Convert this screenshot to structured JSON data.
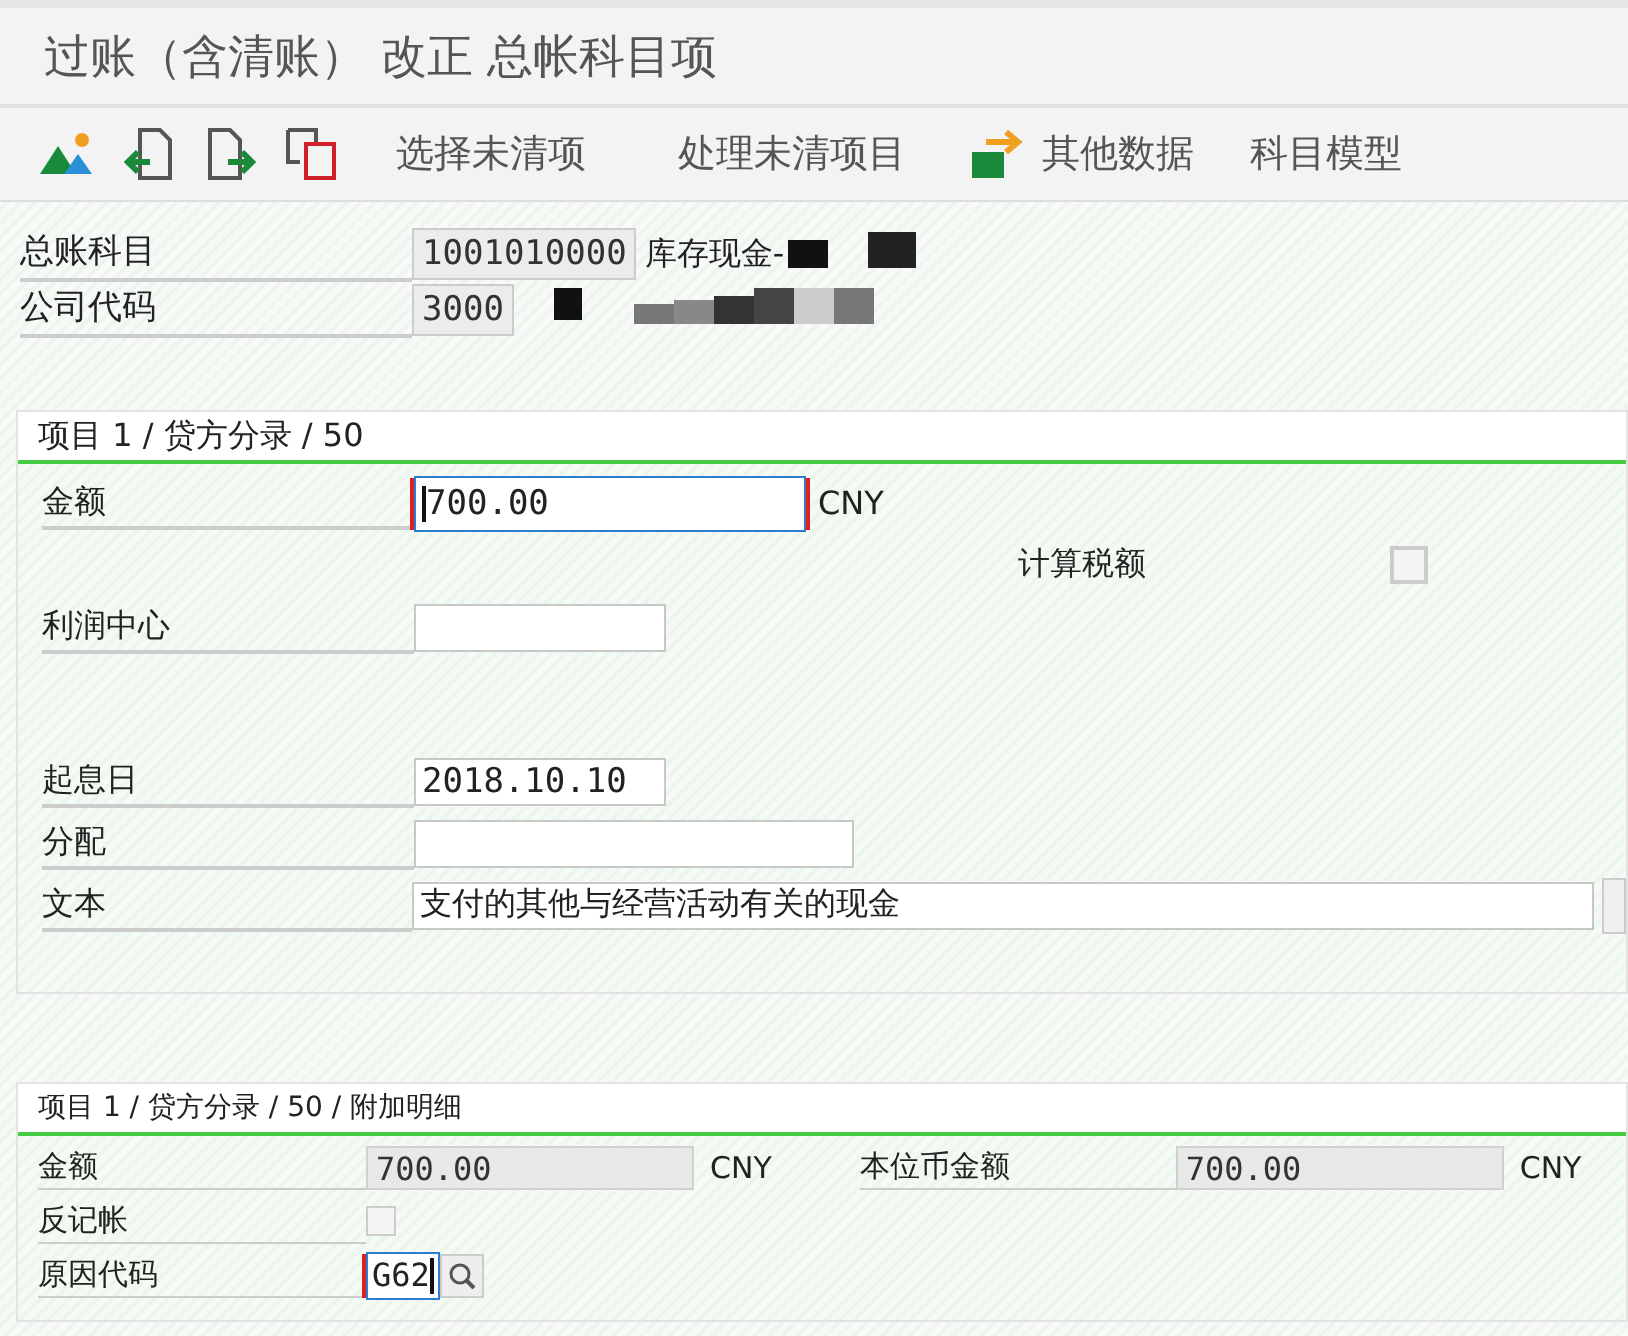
{
  "window": {
    "title": "过账（含清账） 改正 总帐科目项"
  },
  "toolbar": [
    {
      "kind": "icon"
    },
    {
      "kind": "icon"
    },
    {
      "kind": "icon"
    },
    {
      "kind": "icon"
    },
    {
      "kind": "text",
      "label": "选择未清项"
    },
    {
      "kind": "text",
      "label": "处理未清项目"
    },
    {
      "kind": "icon-text",
      "label": "其他数据"
    },
    {
      "kind": "text",
      "label": "科目模型"
    }
  ],
  "header_fields": [
    {
      "label": "总账科目",
      "value": "1001010000",
      "description": "库存现金-"
    },
    {
      "label": "公司代码",
      "value": "3000"
    }
  ],
  "item_panel": {
    "title": "项目 1 / 贷方分录 / 50",
    "fields": [
      {
        "kind": "input",
        "label": "金额",
        "value": "700.00",
        "unit": "CNY",
        "focused": true
      },
      {
        "kind": "checkbox",
        "label": "计算税额",
        "checked": false
      },
      {
        "kind": "input",
        "label": "利润中心",
        "focused": false
      },
      {
        "kind": "input",
        "label": "起息日",
        "value": "2018.10.10",
        "focused": false
      },
      {
        "kind": "input",
        "label": "分配",
        "focused": false
      },
      {
        "kind": "input",
        "label": "文本",
        "value": "支付的其他与经营活动有关的现金",
        "focused": false
      }
    ]
  },
  "detail_panel": {
    "title": "项目 1 / 贷方分录 / 50 / 附加明细",
    "amount": {
      "label": "金额",
      "value": "700.00",
      "unit": "CNY"
    },
    "local_amount": {
      "label": "本位币金额",
      "value": "700.00",
      "unit": "CNY"
    },
    "reversal": {
      "label": "反记帐",
      "checked": false
    },
    "reason_code": {
      "label": "原因代码",
      "value": "G62",
      "focused": true
    }
  }
}
